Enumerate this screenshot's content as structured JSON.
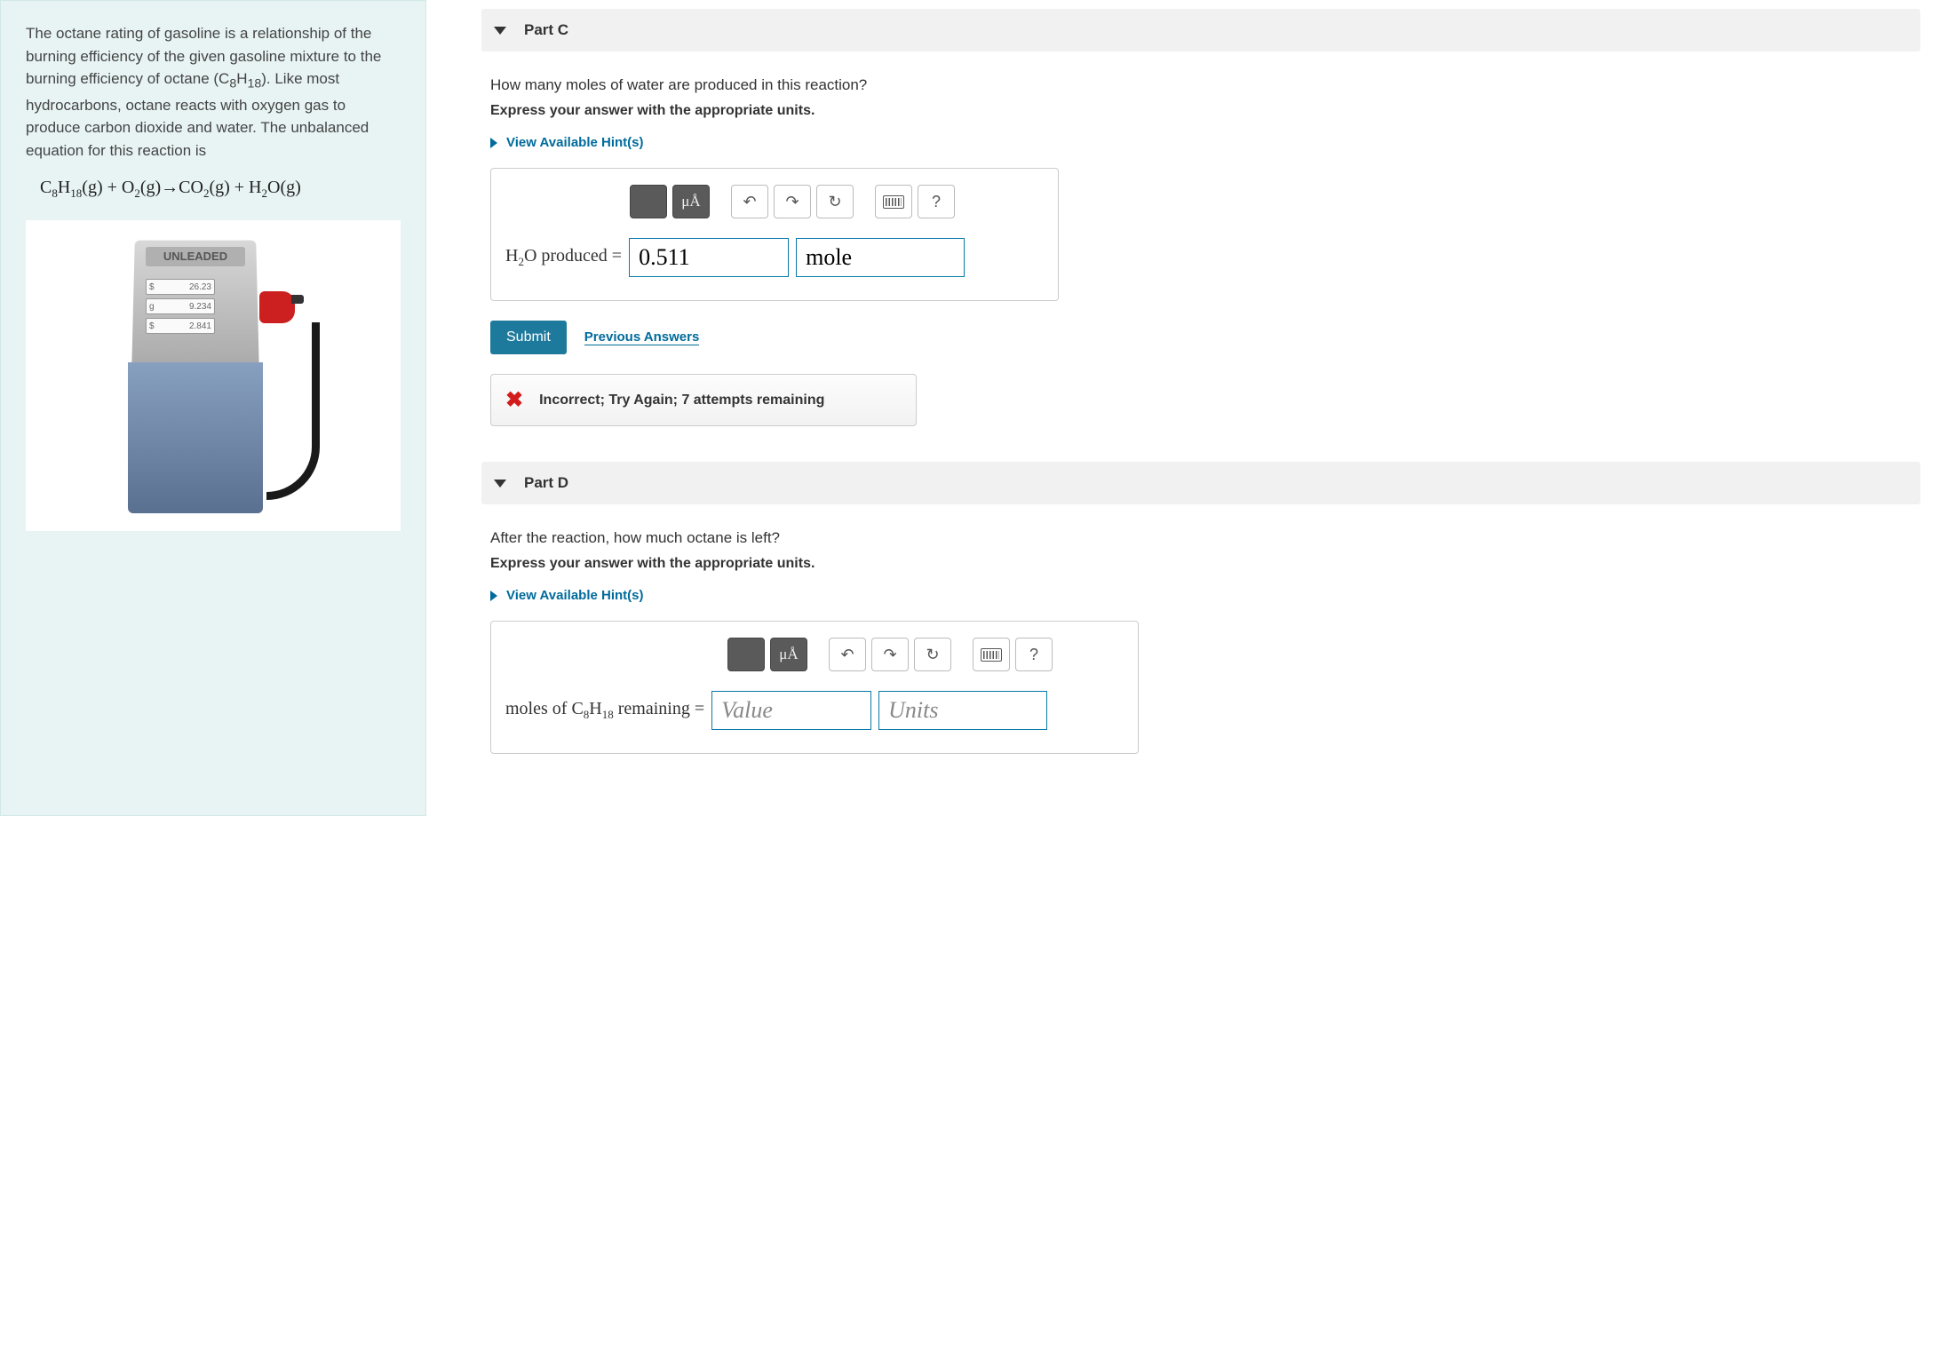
{
  "left": {
    "intro": "The octane rating of gasoline is a relationship of the burning efficiency of the given gasoline mixture to the burning efficiency of octane (C₈H₁₈). Like most hydrocarbons, octane reacts with oxygen gas to produce carbon dioxide and water. The unbalanced equation for this reaction is",
    "pump": {
      "label": "UNLEADED",
      "rows": [
        {
          "left": "$",
          "right": "26.23"
        },
        {
          "left": "g",
          "right": "9.234"
        },
        {
          "left": "$",
          "right": "2.841"
        }
      ]
    }
  },
  "parts": {
    "c": {
      "title": "Part C",
      "question": "How many moles of water are produced in this reaction?",
      "instruction": "Express your answer with the appropriate units.",
      "hints_label": "View Available Hint(s)",
      "answer_label": "H₂O produced =",
      "value": "0.511",
      "units": "mole",
      "submit": "Submit",
      "prev": "Previous Answers",
      "feedback": "Incorrect; Try Again; 7 attempts remaining"
    },
    "d": {
      "title": "Part D",
      "question": "After the reaction, how much octane is left?",
      "instruction": "Express your answer with the appropriate units.",
      "hints_label": "View Available Hint(s)",
      "answer_prefix": "moles of ",
      "answer_mid": " remaining = ",
      "value_placeholder": "Value",
      "units_placeholder": "Units"
    }
  },
  "toolbar": {
    "mu": "μÅ",
    "help": "?"
  }
}
